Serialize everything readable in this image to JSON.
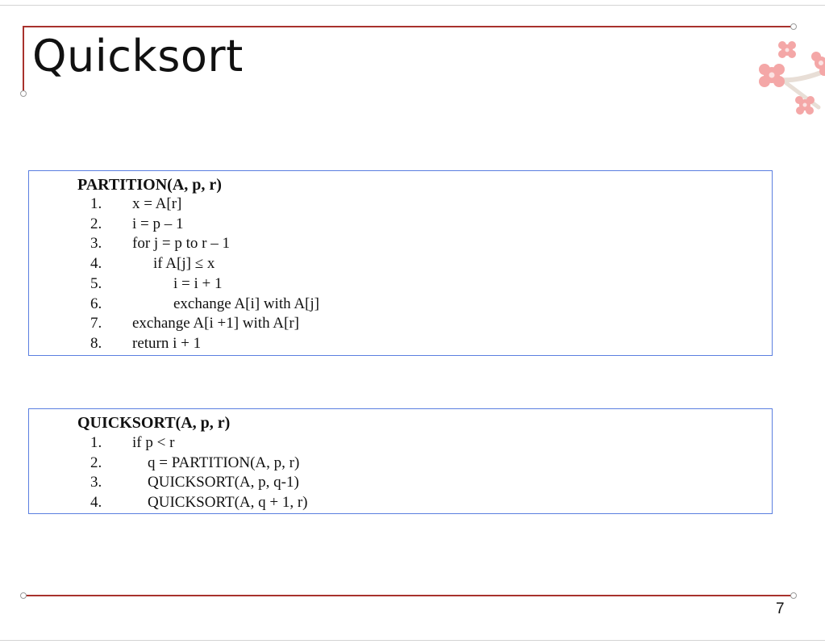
{
  "slide": {
    "title": "Quicksort",
    "page_number": "7"
  },
  "partition": {
    "header": "PARTITION(A, p, r)",
    "lines": [
      {
        "num": "1.",
        "text": "x = A[r]",
        "indent": 0
      },
      {
        "num": "2.",
        "text": "i = p – 1",
        "indent": 0
      },
      {
        "num": "3.",
        "text": "for j = p to r – 1",
        "indent": 0
      },
      {
        "num": "4.",
        "text": "if A[j] ≤ x",
        "indent": 1
      },
      {
        "num": "5.",
        "text": "i = i + 1",
        "indent": 2
      },
      {
        "num": "6.",
        "text": "exchange A[i] with A[j]",
        "indent": 2
      },
      {
        "num": "7.",
        "text": "exchange A[i +1] with A[r]",
        "indent": 0
      },
      {
        "num": "8.",
        "text": "return i + 1",
        "indent": 0
      }
    ]
  },
  "quicksort": {
    "header": "QUICKSORT(A, p, r)",
    "lines": [
      {
        "num": "1.",
        "text": "if p < r",
        "indent": 0
      },
      {
        "num": "2.",
        "text": "q = PARTITION(A, p, r)",
        "indent": 1
      },
      {
        "num": "3.",
        "text": "QUICKSORT(A, p, q-1)",
        "indent": 1
      },
      {
        "num": "4.",
        "text": "QUICKSORT(A, q + 1, r)",
        "indent": 1
      }
    ]
  },
  "colors": {
    "accent_rule": "#a8322d",
    "box_border": "#5b7fe0",
    "blossom": "#f4a7a7"
  },
  "icons": {
    "decoration": "cherry-blossom-icon"
  }
}
